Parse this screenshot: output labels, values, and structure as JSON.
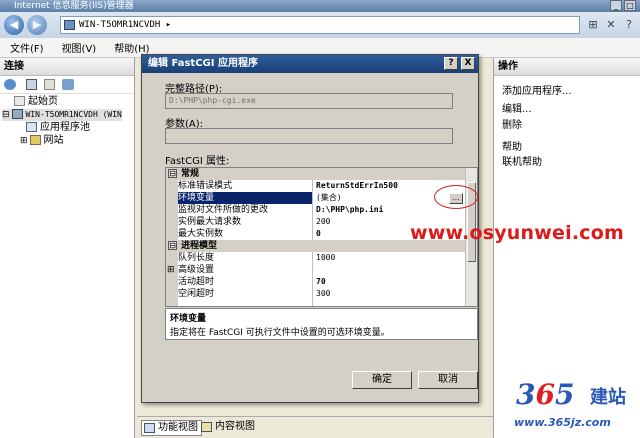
{
  "window": {
    "title": "Internet 信息服务(IIS)管理器"
  },
  "address": {
    "path": "WIN-T5OMR1NCVDH  ▸"
  },
  "menu": [
    {
      "label": "文件(F)"
    },
    {
      "label": "视图(V)"
    },
    {
      "label": "帮助(H)"
    }
  ],
  "connections": {
    "header": "连接",
    "tree": [
      {
        "label": "起始页"
      },
      {
        "label": "WIN-T5OMR1NCVDH (WIN"
      },
      {
        "label": "应用程序池"
      },
      {
        "label": "网站"
      }
    ]
  },
  "actions": {
    "header": "操作",
    "items": [
      {
        "label": "添加应用程序..."
      },
      {
        "label": "编辑..."
      },
      {
        "label": "删除"
      },
      {
        "label": "帮助"
      },
      {
        "label": "联机帮助"
      }
    ]
  },
  "view_tabs": [
    {
      "label": "功能视图"
    },
    {
      "label": "内容视图"
    }
  ],
  "dialog": {
    "title": "编辑 FastCGI 应用程序",
    "help_btn": "?",
    "close_btn": "X",
    "path_label": "完整路径(P):",
    "path_value": "D:\\PHP\\php-cgi.exe",
    "args_label": "参数(A):",
    "args_value": "",
    "props_label": "FastCGI 属性:",
    "properties": [
      {
        "kind": "cat",
        "toggle": "⊟",
        "name": "常规"
      },
      {
        "kind": "prop",
        "name": "标准错误模式",
        "value": "ReturnStdErrIn500"
      },
      {
        "kind": "prop",
        "name": "环境变量",
        "value": "(集合)",
        "selected": true
      },
      {
        "kind": "prop",
        "name": "监视对文件所做的更改",
        "value": "D:\\PHP\\php.ini"
      },
      {
        "kind": "prop",
        "name": "实例最大请求数",
        "value": "200"
      },
      {
        "kind": "prop",
        "name": "最大实例数",
        "value": "0"
      },
      {
        "kind": "cat",
        "toggle": "⊟",
        "name": "进程模型"
      },
      {
        "kind": "prop",
        "name": "队列长度",
        "value": "1000"
      },
      {
        "kind": "prop",
        "name": "高级设置",
        "value": "",
        "toggle": "⊞"
      },
      {
        "kind": "prop",
        "name": "活动超时",
        "value": "70"
      },
      {
        "kind": "prop",
        "name": "空闲超时",
        "value": "300"
      }
    ],
    "ellipsis": "...",
    "desc_title": "环境变量",
    "desc_body": "指定将在 FastCGI 可执行文件中设置的可选环境变量。",
    "ok": "确定",
    "cancel": "取消"
  },
  "watermark": {
    "url": "www.osyunwei.com",
    "logo_num_left": "3",
    "logo_num_red": "6",
    "logo_num_right": "5",
    "logo_cn": "建站",
    "logo_url": "www.365jz.com"
  }
}
